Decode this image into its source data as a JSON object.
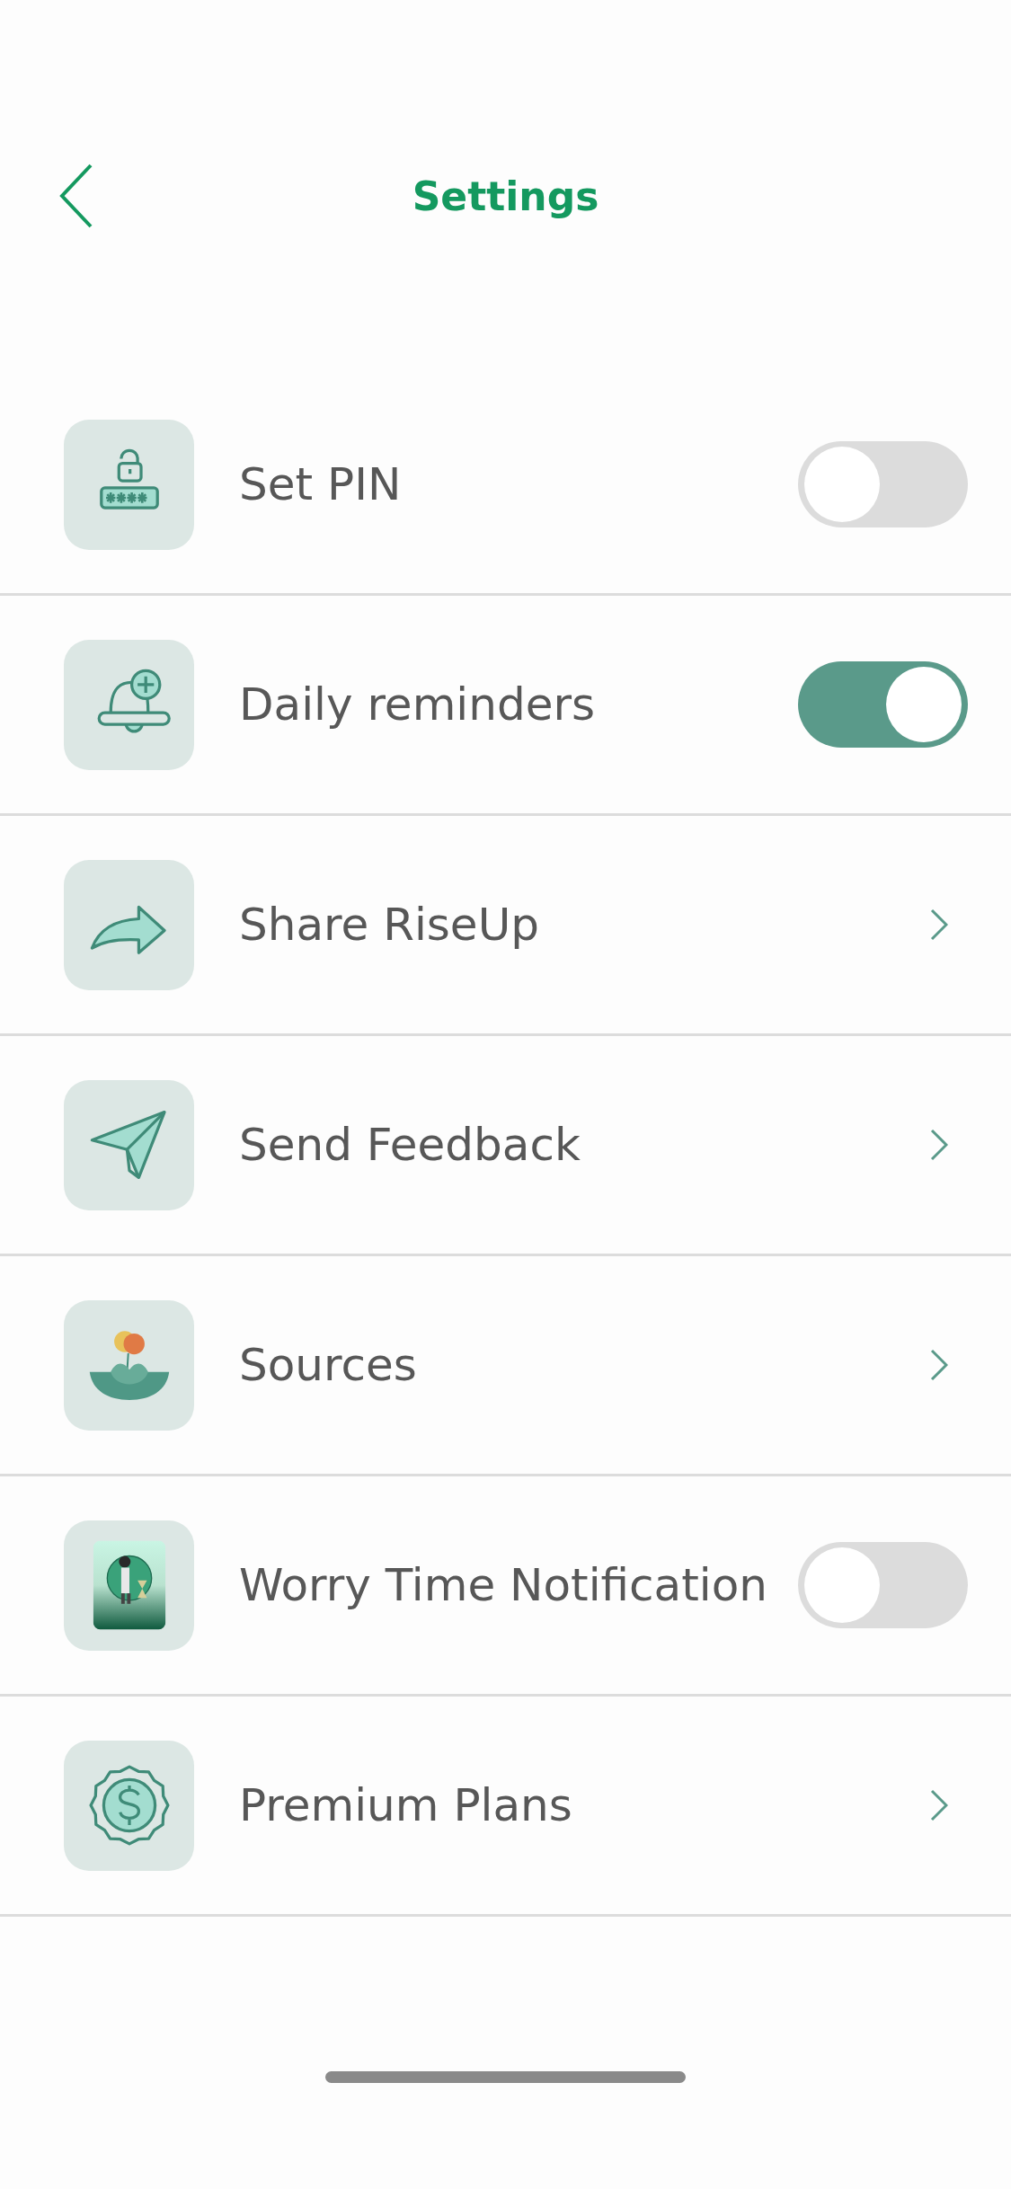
{
  "header": {
    "title": "Settings"
  },
  "items": [
    {
      "label": "Set PIN",
      "kind": "toggle",
      "on": false
    },
    {
      "label": "Daily reminders",
      "kind": "toggle",
      "on": true
    },
    {
      "label": "Share RiseUp",
      "kind": "link"
    },
    {
      "label": "Send Feedback",
      "kind": "link"
    },
    {
      "label": "Sources",
      "kind": "link"
    },
    {
      "label": "Worry Time Notification",
      "kind": "toggle",
      "on": false
    },
    {
      "label": "Premium Plans",
      "kind": "link"
    }
  ]
}
